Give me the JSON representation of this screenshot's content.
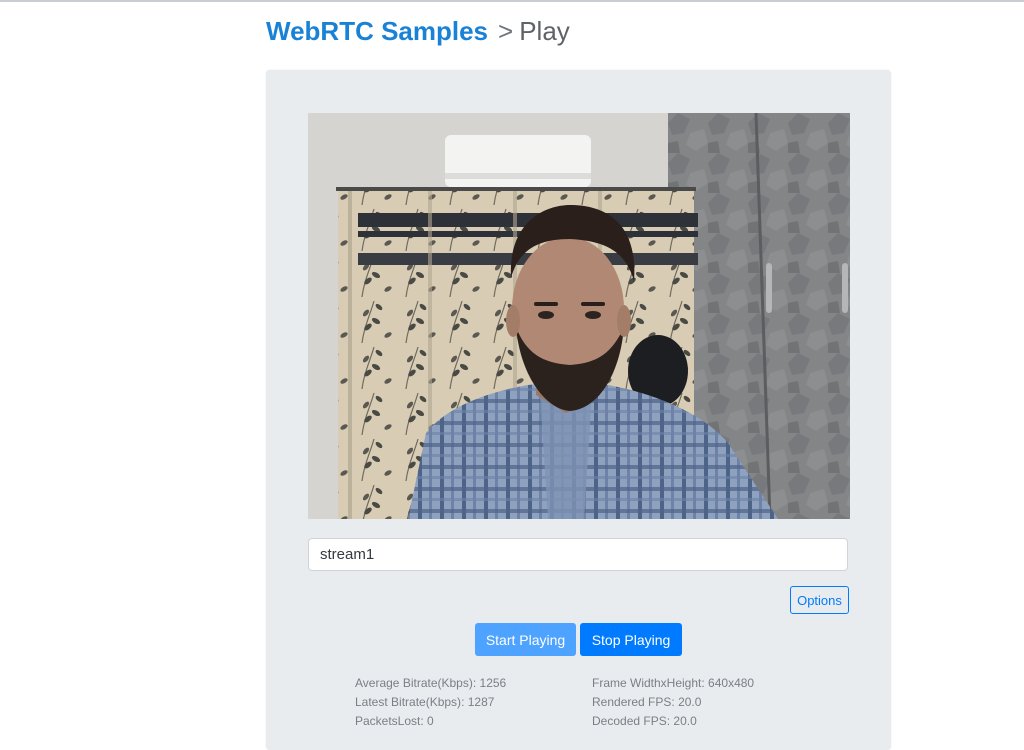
{
  "header": {
    "home_link": "WebRTC Samples",
    "separator": ">",
    "page_title": "Play"
  },
  "player": {
    "stream_id": "stream1",
    "options_label": "Options",
    "start_label": "Start Playing",
    "stop_label": "Stop Playing"
  },
  "stats": {
    "left": [
      {
        "label": "Average Bitrate(Kbps)",
        "value": "1256"
      },
      {
        "label": "Latest Bitrate(Kbps)",
        "value": "1287"
      },
      {
        "label": "PacketsLost",
        "value": "0"
      }
    ],
    "right": [
      {
        "label": "Frame WidthxHeight",
        "value": "640x480"
      },
      {
        "label": "Rendered FPS",
        "value": "20.0"
      },
      {
        "label": "Decoded FPS",
        "value": "20.0"
      }
    ]
  },
  "colors": {
    "link_blue": "#1a82d6",
    "primary": "#007bff",
    "card_bg": "#e9ecef"
  }
}
